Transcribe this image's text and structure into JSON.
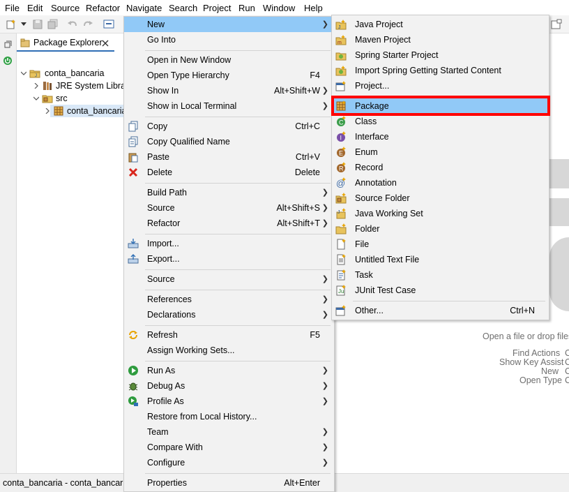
{
  "menubar": [
    "File",
    "Edit",
    "Source",
    "Refactor",
    "Navigate",
    "Search",
    "Project",
    "Run",
    "Window",
    "Help"
  ],
  "package_explorer": {
    "tab_label": "Package Explorer",
    "project": "conta_bancaria",
    "jre": "JRE System Library",
    "src": "src",
    "package": "conta_bancaria"
  },
  "status": {
    "text": "conta_bancaria - conta_bancaria/"
  },
  "editor_hints": {
    "drop": "Open a file or drop files",
    "find_actions": "Find Actions",
    "content_assist": "Show Key Assist",
    "new": "New",
    "open_type": "Open Type"
  },
  "context_menu": [
    {
      "label": "New",
      "accel": "",
      "submenu": true,
      "icon": ""
    },
    {
      "label": "Go Into",
      "accel": "",
      "submenu": false,
      "icon": ""
    },
    {
      "label": "Open in New Window",
      "accel": "",
      "submenu": false,
      "icon": ""
    },
    {
      "label": "Open Type Hierarchy",
      "accel": "F4",
      "submenu": false,
      "icon": ""
    },
    {
      "label": "Show In",
      "accel": "Alt+Shift+W",
      "submenu": true,
      "icon": ""
    },
    {
      "label": "Show in Local Terminal",
      "accel": "",
      "submenu": true,
      "icon": ""
    },
    {
      "label": "Copy",
      "accel": "Ctrl+C",
      "submenu": false,
      "icon": "copy-icon"
    },
    {
      "label": "Copy Qualified Name",
      "accel": "",
      "submenu": false,
      "icon": "copy-qualified-icon"
    },
    {
      "label": "Paste",
      "accel": "Ctrl+V",
      "submenu": false,
      "icon": "paste-icon"
    },
    {
      "label": "Delete",
      "accel": "Delete",
      "submenu": false,
      "icon": "delete-icon"
    },
    {
      "label": "Build Path",
      "accel": "",
      "submenu": true,
      "icon": ""
    },
    {
      "label": "Source",
      "accel": "Alt+Shift+S",
      "submenu": true,
      "icon": ""
    },
    {
      "label": "Refactor",
      "accel": "Alt+Shift+T",
      "submenu": true,
      "icon": ""
    },
    {
      "label": "Import...",
      "accel": "",
      "submenu": false,
      "icon": "import-icon"
    },
    {
      "label": "Export...",
      "accel": "",
      "submenu": false,
      "icon": "export-icon"
    },
    {
      "label": "Source",
      "accel": "",
      "submenu": true,
      "icon": ""
    },
    {
      "label": "References",
      "accel": "",
      "submenu": true,
      "icon": ""
    },
    {
      "label": "Declarations",
      "accel": "",
      "submenu": true,
      "icon": ""
    },
    {
      "label": "Refresh",
      "accel": "F5",
      "submenu": false,
      "icon": "refresh-icon"
    },
    {
      "label": "Assign Working Sets...",
      "accel": "",
      "submenu": false,
      "icon": ""
    },
    {
      "label": "Run As",
      "accel": "",
      "submenu": true,
      "icon": "run-icon"
    },
    {
      "label": "Debug As",
      "accel": "",
      "submenu": true,
      "icon": "debug-icon"
    },
    {
      "label": "Profile As",
      "accel": "",
      "submenu": true,
      "icon": "profile-icon"
    },
    {
      "label": "Restore from Local History...",
      "accel": "",
      "submenu": false,
      "icon": ""
    },
    {
      "label": "Team",
      "accel": "",
      "submenu": true,
      "icon": ""
    },
    {
      "label": "Compare With",
      "accel": "",
      "submenu": true,
      "icon": ""
    },
    {
      "label": "Configure",
      "accel": "",
      "submenu": true,
      "icon": ""
    },
    {
      "label": "Properties",
      "accel": "Alt+Enter",
      "submenu": false,
      "icon": ""
    }
  ],
  "new_submenu": [
    {
      "label": "Java Project",
      "accel": "",
      "icon": "java-project-icon"
    },
    {
      "label": "Maven Project",
      "accel": "",
      "icon": "maven-project-icon"
    },
    {
      "label": "Spring Starter Project",
      "accel": "",
      "icon": "spring-starter-icon"
    },
    {
      "label": "Import Spring Getting Started Content",
      "accel": "",
      "icon": "spring-import-icon"
    },
    {
      "label": "Project...",
      "accel": "",
      "icon": "project-icon"
    },
    {
      "label": "Package",
      "accel": "",
      "icon": "package-icon"
    },
    {
      "label": "Class",
      "accel": "",
      "icon": "class-icon"
    },
    {
      "label": "Interface",
      "accel": "",
      "icon": "interface-icon"
    },
    {
      "label": "Enum",
      "accel": "",
      "icon": "enum-icon"
    },
    {
      "label": "Record",
      "accel": "",
      "icon": "record-icon"
    },
    {
      "label": "Annotation",
      "accel": "",
      "icon": "annotation-icon"
    },
    {
      "label": "Source Folder",
      "accel": "",
      "icon": "source-folder-icon"
    },
    {
      "label": "Java Working Set",
      "accel": "",
      "icon": "working-set-icon"
    },
    {
      "label": "Folder",
      "accel": "",
      "icon": "folder-icon"
    },
    {
      "label": "File",
      "accel": "",
      "icon": "file-icon"
    },
    {
      "label": "Untitled Text File",
      "accel": "",
      "icon": "text-file-icon"
    },
    {
      "label": "Task",
      "accel": "",
      "icon": "task-icon"
    },
    {
      "label": "JUnit Test Case",
      "accel": "",
      "icon": "junit-icon"
    },
    {
      "label": "Other...",
      "accel": "Ctrl+N",
      "icon": "other-icon"
    }
  ],
  "colors": {
    "menu_bg": "#f2f2f2",
    "hover": "#91c9f7",
    "callout": "#ff0000"
  }
}
